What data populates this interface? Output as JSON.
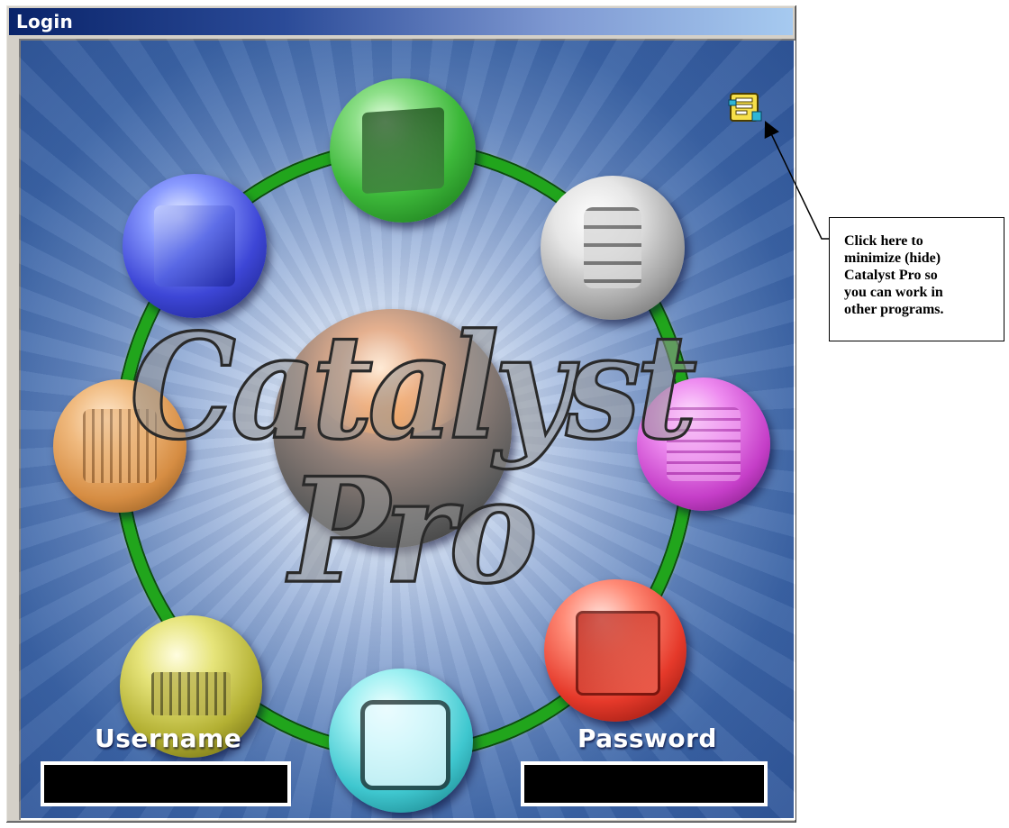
{
  "window": {
    "title": "Login"
  },
  "login": {
    "brand_text": "Catalyst Pro",
    "username_label": "Username",
    "password_label": "Password",
    "username_value": "",
    "password_value": ""
  },
  "help_icon": {
    "name": "help-icon"
  },
  "callout": {
    "text": "Click here to\nminimize (hide)\nCatalyst Pro so\nyou can work in\nother programs."
  },
  "colors": {
    "title_bar_start": "#0a246a",
    "title_bar_end": "#a6caf0",
    "panel_blue": "#2f5598",
    "ring_green": "#21a51c"
  }
}
